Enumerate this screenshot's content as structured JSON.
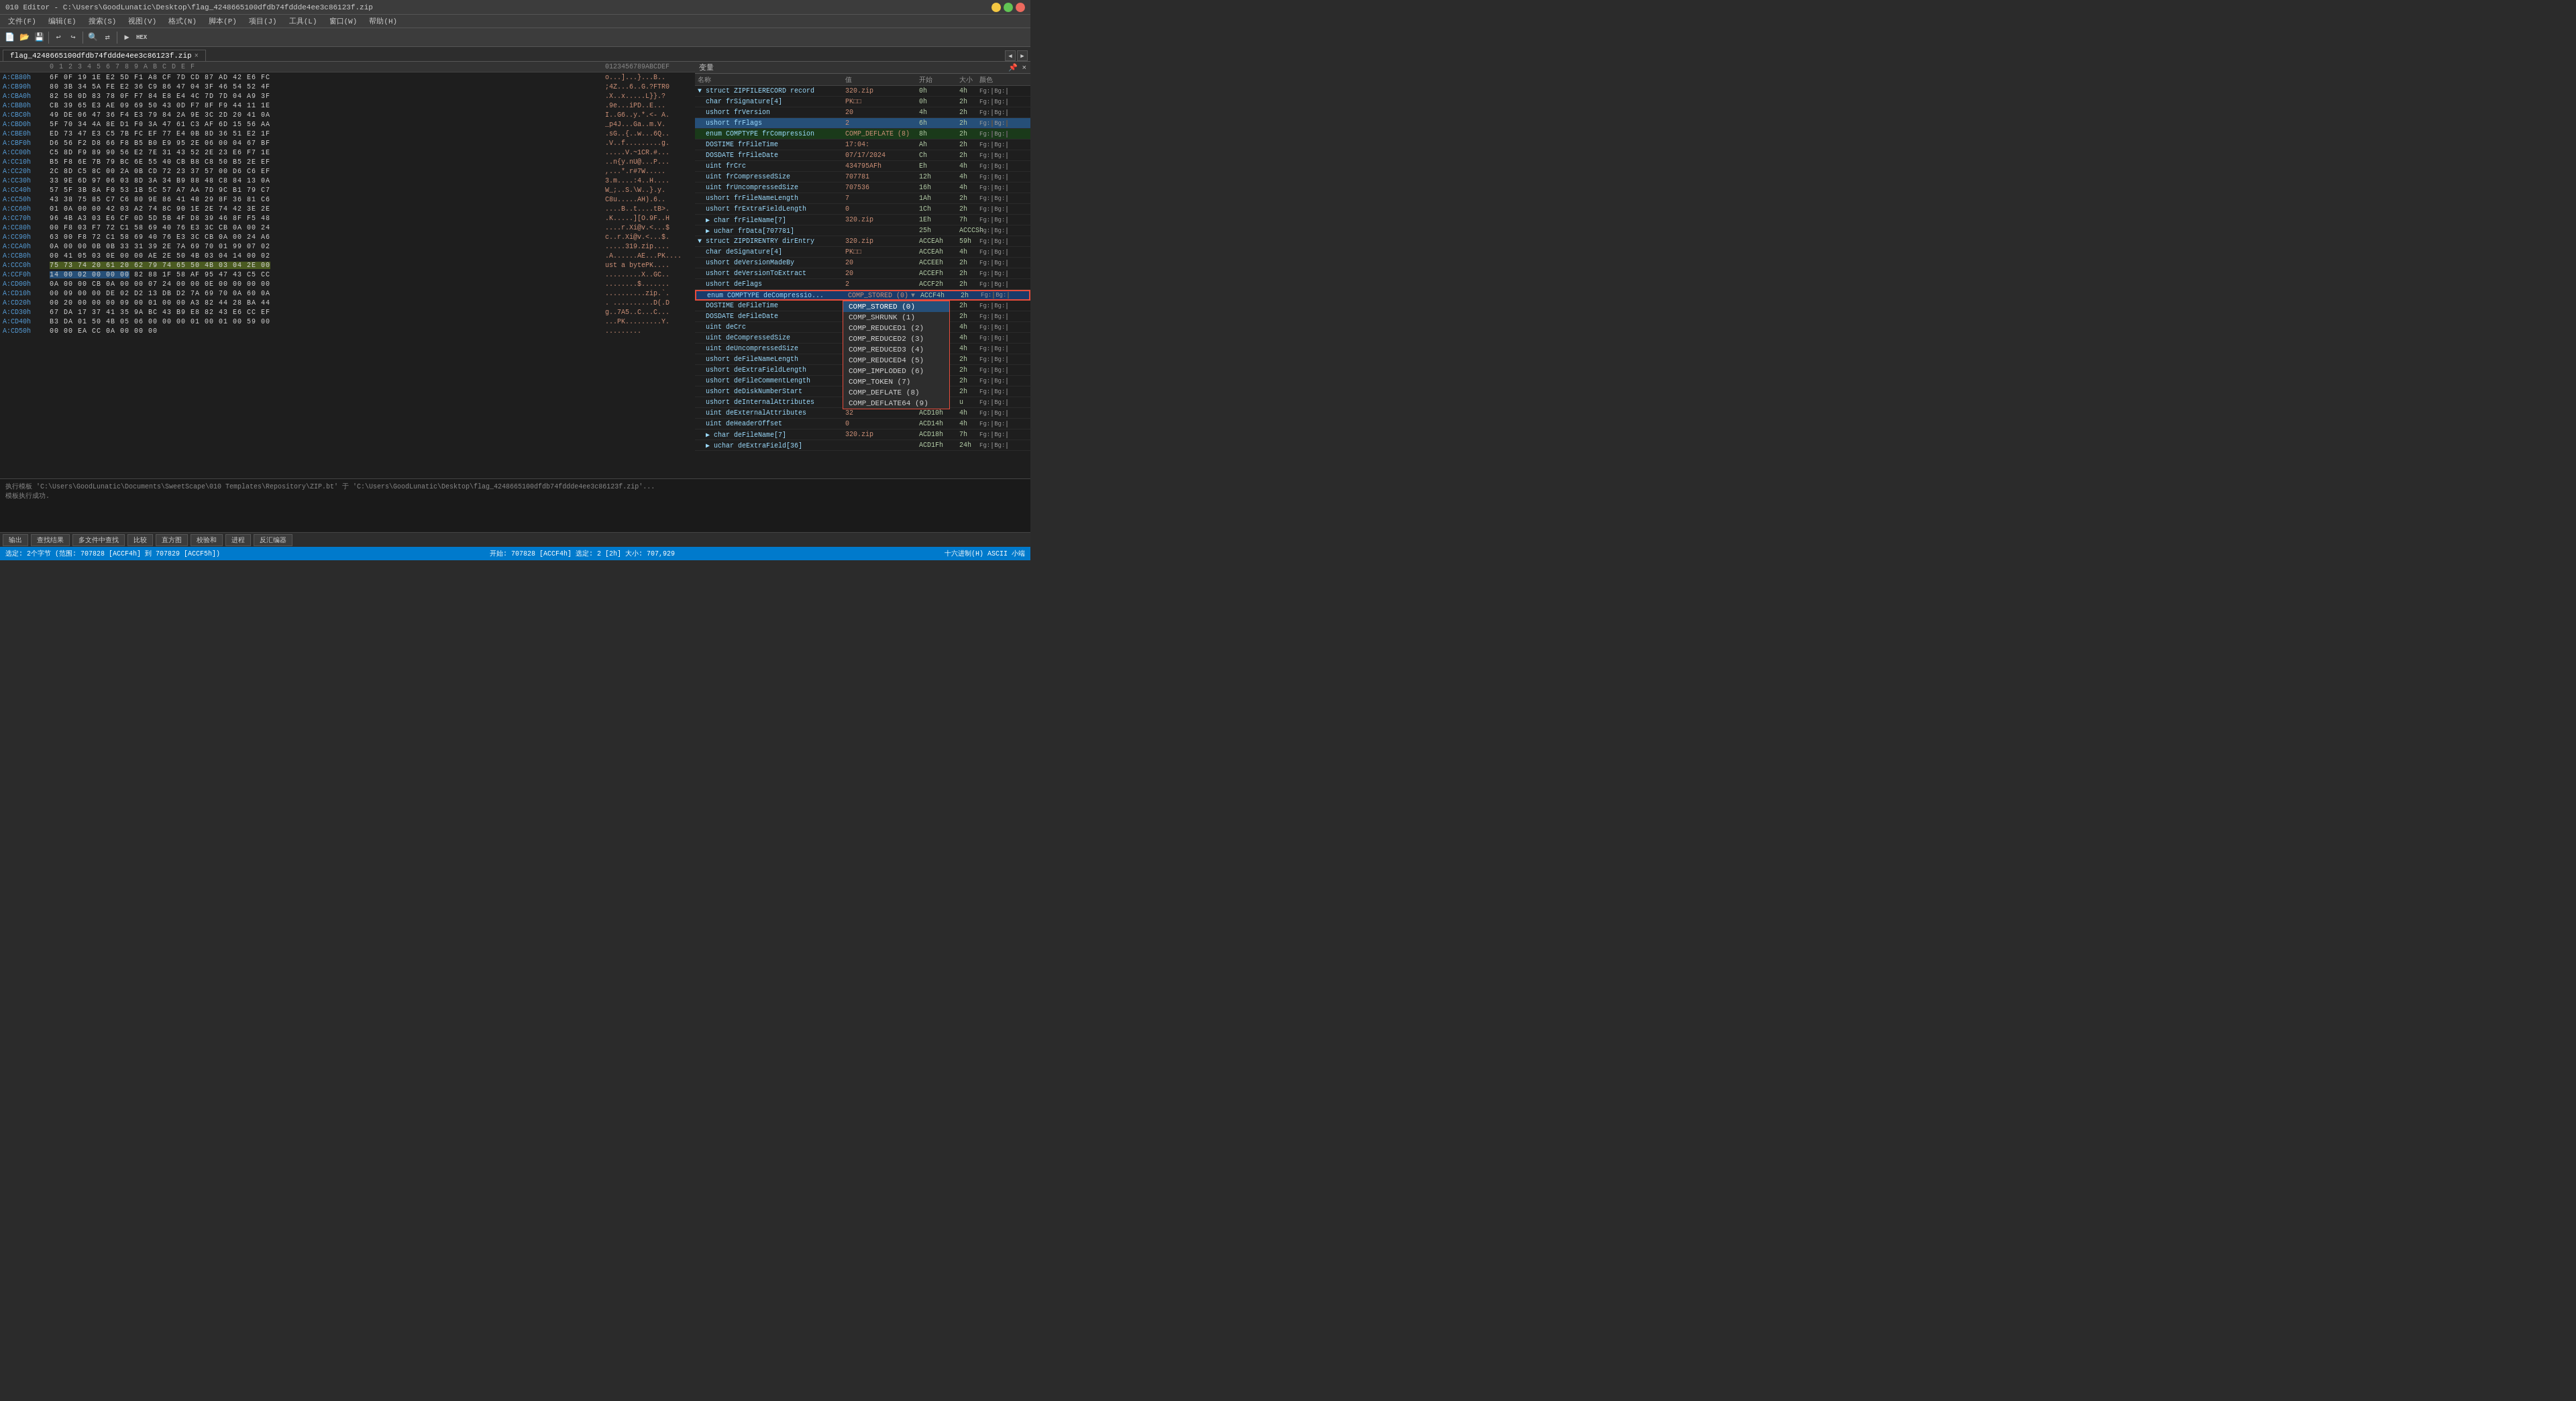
{
  "window": {
    "title": "010 Editor - C:\\Users\\GoodLunatic\\Desktop\\flag_4248665100dfdb74fddde4ee3c86123f.zip",
    "tab_label": "flag_4248665100dfdb74fddde4ee3c86123f.zip",
    "tab_close": "×"
  },
  "menu": {
    "items": [
      "文件(F)",
      "编辑(E)",
      "搜索(S)",
      "视图(V)",
      "格式(N)",
      "脚本(P)",
      "项目(J)",
      "工具(L)",
      "窗口(W)",
      "帮助(H)"
    ]
  },
  "hex_header": {
    "offset_label": "",
    "bytes_label": "0  1  2  3  4  5  6  7  8  9  A  B  C  D  E  F",
    "ascii_label": "0123456789ABCDEF"
  },
  "hex_rows": [
    {
      "addr": "A:CB80h",
      "bytes": "6F 0F 19 1E E2 5D F1 A8 CF 7D CD 87 AD 42 E6 FC",
      "ascii": "o...]...}...B.."
    },
    {
      "addr": "A:CB90h",
      "bytes": "80 3B 34 5A FE E2 36 C9 86 47 04 3F 46 54 52 4F",
      "ascii": ";4Z...6..G.?FTR0"
    },
    {
      "addr": "A:CBA0h",
      "bytes": "82 58 0D 83 78 0F F7 84 E8 E4 4C 7D 7D 04 A9 3F",
      "ascii": ".X..x.....L}}.?"
    },
    {
      "addr": "A:CBB0h",
      "bytes": "CB 39 65 E3 AE 09 69 50 43 0D F7 8F F9 44 11 1E",
      "ascii": ".9e...iPD..E..."
    },
    {
      "addr": "A:CBC0h",
      "bytes": "49 DE 06 47 36 F4 E3 79 84 2A 9E 3C 2D 20 41 0A",
      "ascii": "I..G6..y.*.<- A."
    },
    {
      "addr": "A:CBD0h",
      "bytes": "5F 70 34 4A 8E D1 F0 3A 47 61 C3 AF 6D 15 56 AA",
      "ascii": "_p4J...Ga..m.V."
    },
    {
      "addr": "A:CBE0h",
      "bytes": "ED 73 47 E3 C5 7B FC EF 77 E4 0B 8D 36 51 E2 1F",
      "ascii": ".sG..{..w...6Q.."
    },
    {
      "addr": "A:CBF0h",
      "bytes": "D6 56 F2 D8 66 F8 B5 B0 E9 95 2E 06 00 04 67 BF",
      "ascii": ".V..f.........g."
    },
    {
      "addr": "A:CC00h",
      "bytes": "C5 8D F9 89 90 56 E2 7E 31 43 52 2E 23 E6 F7 1E",
      "ascii": ".....V.~1CR.#..."
    },
    {
      "addr": "A:CC10h",
      "bytes": "B5 F8 6E 7B 79 BC 6E 55 40 CB B8 C8 50 B5 2E EF",
      "ascii": "..n{y.nU@...P..."
    },
    {
      "addr": "A:CC20h",
      "bytes": "2C 8D C5 8C 00 2A 0B CD 72 23 37 57 00 D6 C6 EF",
      "ascii": ",...*.r#7W....."
    },
    {
      "addr": "A:CC30h",
      "bytes": "33 9E 6D 97 06 03 8D 3A 34 B9 88 48 C8 84 13 0A",
      "ascii": "3.m....:4..H...."
    },
    {
      "addr": "A:CC40h",
      "bytes": "57 5F 3B 8A F0 53 1B 5C 57 A7 AA 7D 9C B1 79 C7",
      "ascii": "W_;..S.\\W..}.y."
    },
    {
      "addr": "A:CC50h",
      "bytes": "43 38 75 85 C7 C6 80 9E 86 41 48 29 8F 36 81 C6",
      "ascii": "C8u.....AH).6.."
    },
    {
      "addr": "A:CC60h",
      "bytes": "01 0A 00 00 42 03 A2 74 8C 90 1E 2E 74 42 3E 2E",
      "ascii": "....B..t....tB>."
    },
    {
      "addr": "A:CC70h",
      "bytes": "96 4B A3 03 E6 CF 0D 5D 5B 4F D8 39 46 8F F5 48",
      "ascii": ".K.....][O.9F..H"
    },
    {
      "addr": "A:CC80h",
      "bytes": "00 F8 03 F7 72 C1 58 69 40 76 E3 3C CB 0A 00 24",
      "ascii": "....r.Xi@v.<...$"
    },
    {
      "addr": "A:CC90h",
      "bytes": "63 00 F8 72 C1 58 69 40 76 E3 3C CB 0A 00 24 A6",
      "ascii": "c..r.Xi@v.<...$."
    },
    {
      "addr": "A:CCA0h",
      "bytes": "0A 00 00 0B 0B 33 31 39 2E 7A 69 70 01 99 07 02",
      "ascii": ".....319.zip...."
    },
    {
      "addr": "A:CCB0h",
      "bytes": "00 41 05 03 0E 00 00 AE 2E 50 4B 03 04 14 00 02",
      "ascii": ".A......AE...PK...."
    },
    {
      "addr": "A:CCC0h",
      "bytes": "75 73 74 20 61 20 62 79 74 65 50 4B 03 04 2E 00",
      "ascii": "ust a bytePK...."
    },
    {
      "addr": "A:CCF0h",
      "bytes": "14 00 02 00 00 00 82 88 1F 58 AF 95 47 43 C5 CC",
      "ascii": ".........X..GC.."
    },
    {
      "addr": "A:CD00h",
      "bytes": "0A 00 00 CB 0A 00 00 07 24 00 00 0E 00 00 00 00",
      "ascii": "........$......."
    },
    {
      "addr": "A:CD10h",
      "bytes": "00 09 00 00 DE 02 D2 13 DB D2 7A 69 70 0A 60 0A",
      "ascii": "..........zip.`."
    },
    {
      "addr": "A:CD20h",
      "bytes": "00 20 00 00 00 09 00 01 00 00 A3 82 44 28 BA 44",
      "ascii": ". ..........D(.D"
    },
    {
      "addr": "A:CD30h",
      "bytes": "67 DA 17 37 41 35 9A BC 43 B9 E8 82 43 E6 CC EF",
      "ascii": "g..7A5..C...C..."
    },
    {
      "addr": "A:CD40h",
      "bytes": "B3 DA 01 50 4B 05 06 00 00 00 01 00 01 00 59 00",
      "ascii": "...PK.........Y."
    },
    {
      "addr": "A:CD50h",
      "bytes": "00 00 EA CC 0A 00 00 00",
      "ascii": "........."
    }
  ],
  "vars": {
    "title": "变量",
    "columns": [
      "名称",
      "值",
      "开始",
      "大小",
      "颜色"
    ],
    "rows": [
      {
        "indent": 0,
        "expand": "▼",
        "name": "struct ZIPFILERECORD record",
        "value": "320.zip",
        "start": "0h",
        "size": "4h",
        "fg": "Fg:",
        "bg": "Bg:"
      },
      {
        "indent": 1,
        "expand": "",
        "name": "char frSignature[4]",
        "value": "PK□□",
        "start": "0h",
        "size": "2h",
        "fg": "Fg:",
        "bg": "Bg:"
      },
      {
        "indent": 1,
        "expand": "",
        "name": "ushort frVersion",
        "value": "20",
        "start": "4h",
        "size": "2h",
        "fg": "Fg:",
        "bg": "Bg:"
      },
      {
        "indent": 1,
        "expand": "",
        "name": "ushort frFlags",
        "value": "2",
        "start": "6h",
        "size": "2h",
        "fg": "Fg:",
        "bg": "Bg:",
        "selected": true
      },
      {
        "indent": 1,
        "expand": "",
        "name": "enum COMPTYPE frCompression",
        "value": "COMP_DEFLATE (8)",
        "start": "8h",
        "size": "2h",
        "fg": "Fg:",
        "bg": "Bg:",
        "highlighted": true
      },
      {
        "indent": 1,
        "expand": "",
        "name": "DOSTIME frFileTime",
        "value": "17:04:",
        "start": "Ah",
        "size": "2h",
        "fg": "Fg:",
        "bg": "Bg:"
      },
      {
        "indent": 1,
        "expand": "",
        "name": "DOSDATE frFileDate",
        "value": "07/17/2024",
        "start": "Ch",
        "size": "2h",
        "fg": "Fg:",
        "bg": "Bg:"
      },
      {
        "indent": 1,
        "expand": "",
        "name": "uint frCrc",
        "value": "434795AFh",
        "start": "Eh",
        "size": "4h",
        "fg": "Fg:",
        "bg": "Bg:"
      },
      {
        "indent": 1,
        "expand": "",
        "name": "uint frCompressedSize",
        "value": "707781",
        "start": "12h",
        "size": "4h",
        "fg": "Fg:",
        "bg": "Bg:"
      },
      {
        "indent": 1,
        "expand": "",
        "name": "uint frUncompressedSize",
        "value": "707536",
        "start": "16h",
        "size": "4h",
        "fg": "Fg:",
        "bg": "Bg:"
      },
      {
        "indent": 1,
        "expand": "",
        "name": "ushort frFileNameLength",
        "value": "7",
        "start": "1Ah",
        "size": "2h",
        "fg": "Fg:",
        "bg": "Bg:"
      },
      {
        "indent": 1,
        "expand": "",
        "name": "ushort frExtraFieldLength",
        "value": "0",
        "start": "1Ch",
        "size": "2h",
        "fg": "Fg:",
        "bg": "Bg:"
      },
      {
        "indent": 1,
        "expand": "▶",
        "name": "char frFileName[7]",
        "value": "320.zip",
        "start": "1Eh",
        "size": "7h",
        "fg": "Fg:",
        "bg": "Bg:"
      },
      {
        "indent": 1,
        "expand": "▶",
        "name": "uchar frData[707781]",
        "value": "",
        "start": "25h",
        "size": "ACCCSh",
        "fg": "Fg:",
        "bg": "Bg:"
      },
      {
        "indent": 0,
        "expand": "▼",
        "name": "struct ZIPDIRENTRY dirEntry",
        "value": "320.zip",
        "start": "ACCEAh",
        "size": "59h",
        "fg": "Fg:",
        "bg": "Bg:"
      },
      {
        "indent": 1,
        "expand": "",
        "name": "char deSignature[4]",
        "value": "PK□□",
        "start": "ACCEAh",
        "size": "4h",
        "fg": "Fg:",
        "bg": "Bg:"
      },
      {
        "indent": 1,
        "expand": "",
        "name": "ushort deVersionMadeBy",
        "value": "20",
        "start": "ACCEEh",
        "size": "2h",
        "fg": "Fg:",
        "bg": "Bg:"
      },
      {
        "indent": 1,
        "expand": "",
        "name": "ushort deVersionToExtract",
        "value": "20",
        "start": "ACCEFh",
        "size": "2h",
        "fg": "Fg:",
        "bg": "Bg:"
      },
      {
        "indent": 1,
        "expand": "",
        "name": "ushort deFlags",
        "value": "2",
        "start": "ACCF2h",
        "size": "2h",
        "fg": "Fg:",
        "bg": "Bg:"
      },
      {
        "indent": 1,
        "expand": "",
        "name": "enum COMPTYPE deCompressio...",
        "value": "COMP_STORED (0)",
        "start": "ACCF4h",
        "size": "2h",
        "fg": "Fg:",
        "bg": "Bg:",
        "comp_selected": true
      },
      {
        "indent": 1,
        "expand": "",
        "name": "DOSTIME deFileTime",
        "value": "",
        "start": "ACCF6h",
        "size": "2h",
        "fg": "Fg:",
        "bg": "Bg:"
      },
      {
        "indent": 1,
        "expand": "",
        "name": "DOSDATE deFileDate",
        "value": "",
        "start": "ACCF8h",
        "size": "2h",
        "fg": "Fg:",
        "bg": "Bg:"
      },
      {
        "indent": 1,
        "expand": "",
        "name": "uint deCrc",
        "value": "",
        "start": "ACCFAh",
        "size": "4h",
        "fg": "Fg:",
        "bg": "Bg:"
      },
      {
        "indent": 1,
        "expand": "",
        "name": "uint deCompressedSize",
        "value": "",
        "start": "ACCFEh",
        "size": "4h",
        "fg": "Fg:",
        "bg": "Bg:"
      },
      {
        "indent": 1,
        "expand": "",
        "name": "uint deUncompressedSize",
        "value": "",
        "start": "ACD02h",
        "size": "4h",
        "fg": "Fg:",
        "bg": "Bg:"
      },
      {
        "indent": 1,
        "expand": "",
        "name": "ushort deFileNameLength",
        "value": "",
        "start": "ACD06h",
        "size": "2h",
        "fg": "Fg:",
        "bg": "Bg:"
      },
      {
        "indent": 1,
        "expand": "",
        "name": "ushort deExtraFieldLength",
        "value": "",
        "start": "ACD08h",
        "size": "2h",
        "fg": "Fg:",
        "bg": "Bg:"
      },
      {
        "indent": 1,
        "expand": "",
        "name": "ushort deFileCommentLength",
        "value": "",
        "start": "ACD0Ah",
        "size": "2h",
        "fg": "Fg:",
        "bg": "Bg:"
      },
      {
        "indent": 1,
        "expand": "",
        "name": "ushort deDiskNumberStart",
        "value": "",
        "start": "ACD0Ch",
        "size": "2h",
        "fg": "Fg:",
        "bg": "Bg:"
      },
      {
        "indent": 1,
        "expand": "",
        "name": "ushort deInternalAttributes",
        "value": "",
        "start": "ACD0Eh",
        "size": "u",
        "fg": "Fg:",
        "bg": "Bg:"
      },
      {
        "indent": 1,
        "expand": "",
        "name": "uint deExternalAttributes",
        "value": "32",
        "start": "ACD10h",
        "size": "4h",
        "fg": "Fg:",
        "bg": "Bg:"
      },
      {
        "indent": 1,
        "expand": "",
        "name": "uint deHeaderOffset",
        "value": "0",
        "start": "ACD14h",
        "size": "4h",
        "fg": "Fg:",
        "bg": "Bg:"
      },
      {
        "indent": 1,
        "expand": "▶",
        "name": "char deFileName[7]",
        "value": "320.zip",
        "start": "ACD18h",
        "size": "7h",
        "fg": "Fg:",
        "bg": "Bg:"
      },
      {
        "indent": 1,
        "expand": "▶",
        "name": "uchar deExtraField[36]",
        "value": "",
        "start": "ACD1Fh",
        "size": "24h",
        "fg": "Fg:",
        "bg": "Bg:"
      }
    ],
    "dropdown": {
      "visible": true,
      "options": [
        {
          "label": "COMP_STORED (0)",
          "value": 0,
          "selected": true
        },
        {
          "label": "COMP_SHRUNK (1)",
          "value": 1
        },
        {
          "label": "COMP_REDUCED1 (2)",
          "value": 2
        },
        {
          "label": "COMP_REDUCED2 (3)",
          "value": 3
        },
        {
          "label": "COMP_REDUCED3 (4)",
          "value": 4
        },
        {
          "label": "COMP_REDUCED4 (5)",
          "value": 5
        },
        {
          "label": "COMP_IMPLODED (6)",
          "value": 6
        },
        {
          "label": "COMP_TOKEN (7)",
          "value": 7
        },
        {
          "label": "COMP_DEFLATE (8)",
          "value": 8
        },
        {
          "label": "COMP_DEFLATE64 (9)",
          "value": 9
        }
      ]
    }
  },
  "output": {
    "label": "输出",
    "log_lines": [
      "执行模板 'C:\\Users\\GoodLunatic\\Documents\\SweetScape\\010 Templates\\Repository\\ZIP.bt' 于 'C:\\Users\\GoodLunatic\\Desktop\\flag_4248665100dfdb74fddde4ee3c86123f.zip'...",
      "模板执行成功."
    ]
  },
  "bottom_toolbar": {
    "buttons": [
      "输出",
      "查找结果",
      "多文件中查找",
      "比较",
      "直方图",
      "校验和",
      "进程",
      "反汇编器"
    ]
  },
  "status_bar": {
    "selection": "选定: 2个字节 (范围: 707828 [ACCF4h] 到 707829 [ACCF5h])",
    "position": "开始: 707828 [ACCF4h]  选定: 2 [2h]  大小: 707,929",
    "encoding": "十六进制(H)  ASCII  小端"
  }
}
